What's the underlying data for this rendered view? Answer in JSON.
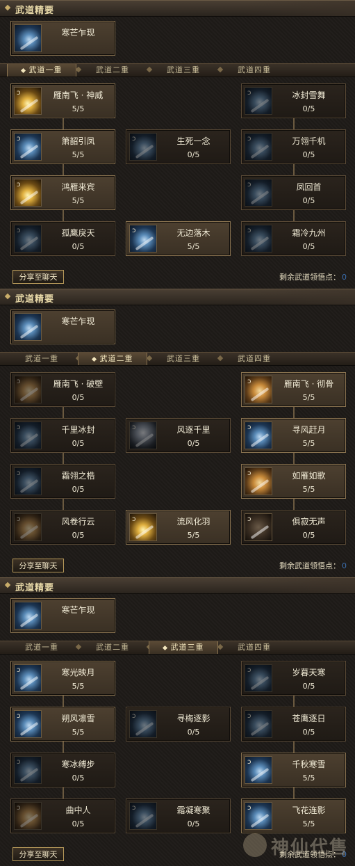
{
  "panels": [
    {
      "header": "武道精要",
      "feature": {
        "name": "寒芒乍现",
        "icon": "ice-blade-icon"
      },
      "tabs": [
        "武道一重",
        "武道二重",
        "武道三重",
        "武道四重"
      ],
      "active_tab": 0,
      "cards": [
        {
          "name": "雁南飞 · 神威",
          "value": "5/5",
          "col": 0,
          "row": 0,
          "active": true,
          "style": "gold"
        },
        {
          "name": "冰封雪舞",
          "value": "0/5",
          "col": 2,
          "row": 0,
          "active": false,
          "style": "ice-dim"
        },
        {
          "name": "箫韶引凤",
          "value": "5/5",
          "col": 0,
          "row": 1,
          "active": true,
          "style": "ice"
        },
        {
          "name": "生死一念",
          "value": "0/5",
          "col": 1,
          "row": 1,
          "active": false,
          "style": "ice-dim"
        },
        {
          "name": "万翎千机",
          "value": "0/5",
          "col": 2,
          "row": 1,
          "active": false,
          "style": "ice-dim"
        },
        {
          "name": "鸿雁来宾",
          "value": "5/5",
          "col": 0,
          "row": 2,
          "active": true,
          "style": "gold"
        },
        {
          "name": "凤回首",
          "value": "0/5",
          "col": 2,
          "row": 2,
          "active": false,
          "style": "ice-dim"
        },
        {
          "name": "孤鹰戾天",
          "value": "0/5",
          "col": 0,
          "row": 3,
          "active": false,
          "style": "ice-dim"
        },
        {
          "name": "无边落木",
          "value": "5/5",
          "col": 1,
          "row": 3,
          "active": true,
          "style": "ice"
        },
        {
          "name": "霜冷九州",
          "value": "0/5",
          "col": 2,
          "row": 3,
          "active": false,
          "style": "ice-dim"
        }
      ],
      "share": "分享至聊天",
      "points_label": "剩余武道领悟点：",
      "points_value": "0"
    },
    {
      "header": "武道精要",
      "feature": {
        "name": "寒芒乍现",
        "icon": "ice-blade-icon"
      },
      "tabs": [
        "武道一重",
        "武道二重",
        "武道三重",
        "武道四重"
      ],
      "active_tab": 1,
      "cards": [
        {
          "name": "雁南飞 · 破壁",
          "value": "0/5",
          "col": 0,
          "row": 0,
          "active": false,
          "style": "fire-dim"
        },
        {
          "name": "雁南飞 · 彻骨",
          "value": "5/5",
          "col": 2,
          "row": 0,
          "active": true,
          "style": "fire"
        },
        {
          "name": "千里冰封",
          "value": "0/5",
          "col": 0,
          "row": 1,
          "active": false,
          "style": "ice-dim"
        },
        {
          "name": "风逐千里",
          "value": "0/5",
          "col": 1,
          "row": 1,
          "active": false,
          "style": "face"
        },
        {
          "name": "寻风赶月",
          "value": "5/5",
          "col": 2,
          "row": 1,
          "active": true,
          "style": "ice"
        },
        {
          "name": "霜翎之梏",
          "value": "0/5",
          "col": 0,
          "row": 2,
          "active": false,
          "style": "ice-dim"
        },
        {
          "name": "如雁如歌",
          "value": "5/5",
          "col": 2,
          "row": 2,
          "active": true,
          "style": "fire"
        },
        {
          "name": "风卷行云",
          "value": "0/5",
          "col": 0,
          "row": 3,
          "active": false,
          "style": "fire-dim"
        },
        {
          "name": "流风化羽",
          "value": "5/5",
          "col": 1,
          "row": 3,
          "active": true,
          "style": "gold"
        },
        {
          "name": "俱寂无声",
          "value": "0/5",
          "col": 2,
          "row": 3,
          "active": false,
          "style": "dark"
        }
      ],
      "share": "分享至聊天",
      "points_label": "剩余武道领悟点：",
      "points_value": "0"
    },
    {
      "header": "武道精要",
      "feature": {
        "name": "寒芒乍现",
        "icon": "ice-blade-icon"
      },
      "tabs": [
        "武道一重",
        "武道二重",
        "武道三重",
        "武道四重"
      ],
      "active_tab": 2,
      "cards": [
        {
          "name": "寒光映月",
          "value": "5/5",
          "col": 0,
          "row": 0,
          "active": true,
          "style": "ice"
        },
        {
          "name": "岁暮天寒",
          "value": "0/5",
          "col": 2,
          "row": 0,
          "active": false,
          "style": "ice-dim"
        },
        {
          "name": "朔风凛雪",
          "value": "5/5",
          "col": 0,
          "row": 1,
          "active": true,
          "style": "ice"
        },
        {
          "name": "寻梅逐影",
          "value": "0/5",
          "col": 1,
          "row": 1,
          "active": false,
          "style": "ice-dim"
        },
        {
          "name": "苍鹰逐日",
          "value": "0/5",
          "col": 2,
          "row": 1,
          "active": false,
          "style": "ice-dim"
        },
        {
          "name": "寒冰缚步",
          "value": "0/5",
          "col": 0,
          "row": 2,
          "active": false,
          "style": "ice-dim"
        },
        {
          "name": "千秋寒雪",
          "value": "5/5",
          "col": 2,
          "row": 2,
          "active": true,
          "style": "ice"
        },
        {
          "name": "曲中人",
          "value": "0/5",
          "col": 0,
          "row": 3,
          "active": false,
          "style": "fire-dim"
        },
        {
          "name": "霜凝寒聚",
          "value": "0/5",
          "col": 1,
          "row": 3,
          "active": false,
          "style": "ice-dim"
        },
        {
          "name": "飞花连影",
          "value": "5/5",
          "col": 2,
          "row": 3,
          "active": true,
          "style": "ice"
        }
      ],
      "share": "分享至聊天",
      "points_label": "剩余武道领悟点：",
      "points_value": "0"
    }
  ],
  "watermark": "神仙代售"
}
